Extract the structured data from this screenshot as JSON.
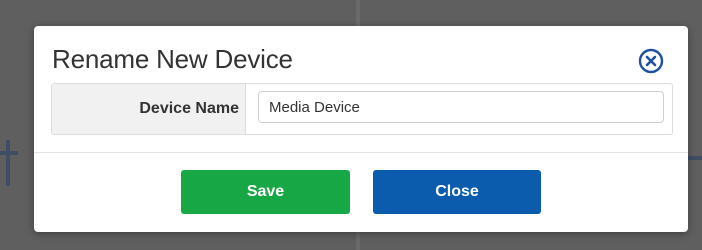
{
  "dialog": {
    "title": "Rename New Device",
    "field": {
      "label": "Device Name",
      "value": "Media Device"
    },
    "buttons": {
      "save_label": "Save",
      "close_label": "Close"
    },
    "close_icon": "close-circle-icon"
  },
  "colors": {
    "backdrop": "#5f5f5f",
    "save": "#17a845",
    "close": "#0b5cad",
    "close_icon": "#1f4fa0"
  }
}
